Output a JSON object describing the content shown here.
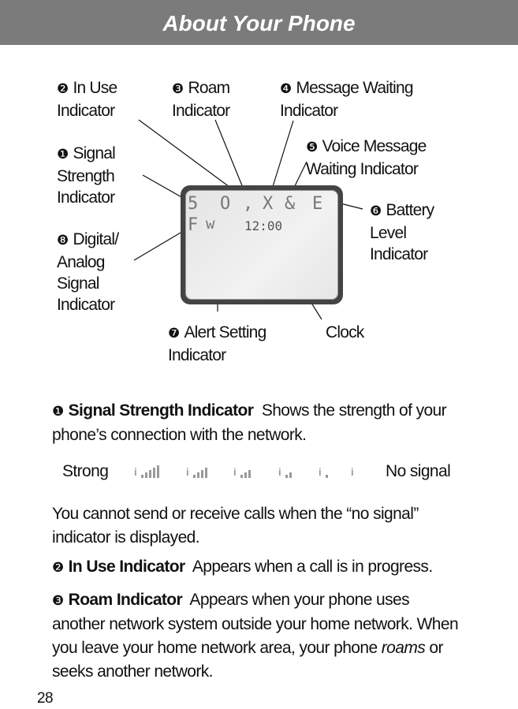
{
  "header": {
    "title": "About Your Phone"
  },
  "diagram": {
    "labels": {
      "in_use": {
        "num": "❷",
        "text": "In Use Indicator"
      },
      "roam": {
        "num": "❸",
        "text": "Roam Indicator"
      },
      "message": {
        "num": "❹",
        "text": "Message Waiting Indicator"
      },
      "signal": {
        "num": "❶",
        "text": "Signal Strength Indicator"
      },
      "voice": {
        "num": "❺",
        "text": "Voice Message Waiting Indicator"
      },
      "battery": {
        "num": "❻",
        "text": "Battery Level Indicator"
      },
      "digital": {
        "num": "❽",
        "text": "Digital/ Analog Signal Indicator"
      },
      "alert": {
        "num": "❼",
        "text": "Alert Setting Indicator"
      },
      "clock": {
        "text": "Clock"
      }
    },
    "screen": {
      "glyphs_row1": [
        "5",
        "O",
        ",",
        "X",
        "&",
        "E"
      ],
      "glyphs_row2": [
        "F",
        "w"
      ],
      "time": "12:00"
    }
  },
  "sections": [
    {
      "num": "❶",
      "title": "Signal Strength Indicator",
      "text": "Shows the strength of your phone’s connection with the network."
    },
    {
      "num": "❷",
      "title": "In Use Indicator",
      "text": "Appears when a call is in progress."
    },
    {
      "num": "❸",
      "title": "Roam Indicator",
      "text": "Appears when your phone uses another network system outside your home network. When you leave your home network area, your phone",
      "em": "roams",
      "tail": "or seeks another network."
    }
  ],
  "signal_scale": {
    "strong": "Strong",
    "none": "No signal",
    "levels": [
      5,
      4,
      3,
      2,
      1,
      0
    ]
  },
  "no_signal_note": "You cannot send or receive calls when the “no signal” indicator is displayed.",
  "page_number": "28"
}
